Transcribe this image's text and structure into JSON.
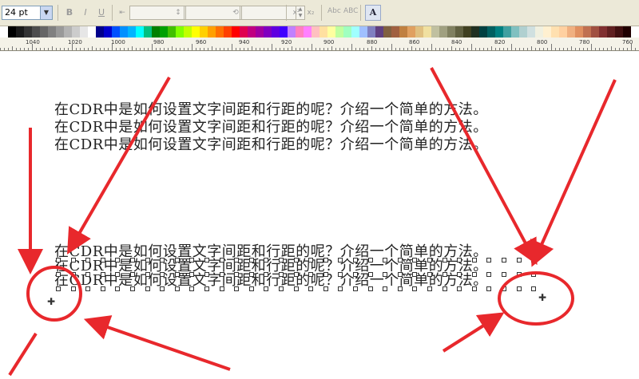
{
  "toolbar": {
    "font_size": "24 pt",
    "icons": [
      "bold-icon",
      "italic-icon",
      "underline-icon",
      "character-spacing-icon",
      "word-spacing-icon",
      "line-spacing-icon",
      "superscript-icon",
      "subscript-icon",
      "uppercase-abc-icon",
      "lowercase-abc-icon",
      "text-properties-icon"
    ],
    "abc_upper": "Abc",
    "abc_lower": "ABC"
  },
  "palette": {
    "colors": [
      "#ffffff",
      "#000000",
      "#1a1a1a",
      "#333333",
      "#4d4d4d",
      "#666666",
      "#808080",
      "#999999",
      "#b3b3b3",
      "#cccccc",
      "#e6e6e6",
      "#ffffff",
      "#00008b",
      "#0000cd",
      "#0050ff",
      "#0090ff",
      "#00b4ff",
      "#00ffff",
      "#00c080",
      "#008000",
      "#00a000",
      "#40c000",
      "#80ff00",
      "#c0ff00",
      "#ffff00",
      "#ffd000",
      "#ffa000",
      "#ff7000",
      "#ff4000",
      "#ff0000",
      "#e00050",
      "#c00080",
      "#a000a0",
      "#8000c0",
      "#6000e0",
      "#4000ff",
      "#c080ff",
      "#ff80c0",
      "#ff80ff",
      "#ffc0c0",
      "#ffe0a0",
      "#ffffa0",
      "#c0ffa0",
      "#a0ffc0",
      "#a0ffff",
      "#a0c0ff",
      "#8080c0",
      "#604080",
      "#806040",
      "#a06040",
      "#c08040",
      "#e0a060",
      "#e0c080",
      "#f0e0a0",
      "#c0c0a0",
      "#a0a080",
      "#808060",
      "#606040",
      "#404020",
      "#203020",
      "#004040",
      "#006060",
      "#008080",
      "#40a0a0",
      "#80c0c0",
      "#b0d0d0",
      "#d0e0e0",
      "#f0f0e0",
      "#fff0d0",
      "#ffe0b0",
      "#ffd0a0",
      "#f0b080",
      "#e09060",
      "#c07050",
      "#a05040",
      "#803030",
      "#602020",
      "#401010",
      "#200000",
      "#ffffff"
    ]
  },
  "ruler": {
    "labels": [
      "1040",
      "1020",
      "1000",
      "980",
      "960",
      "940",
      "920",
      "900",
      "880",
      "860",
      "840",
      "820",
      "800",
      "780",
      "760"
    ]
  },
  "canvas": {
    "normal_lines": [
      "在CDR中是如何设置文字间距和行距的呢？介绍一个简单的方法。",
      "在CDR中是如何设置文字间距和行距的呢？介绍一个简单的方法。",
      "在CDR中是如何设置文字间距和行距的呢？介绍一个简单的方法。"
    ],
    "selected_lines": [
      "在CDR中是如何设置文字间距和行距的呢？介绍一个简单的方法。",
      "在CDR中是如何设置文字间距和行距的呢？介绍一个简单的方法。",
      "在CDR中是如何设置文字间距和行距的呢？介绍一个简单的方法。"
    ]
  },
  "colors": {
    "annotation": "#e8282c",
    "toolbar_bg": "#ece9d8",
    "ruler_bg": "#f4f2e8"
  }
}
